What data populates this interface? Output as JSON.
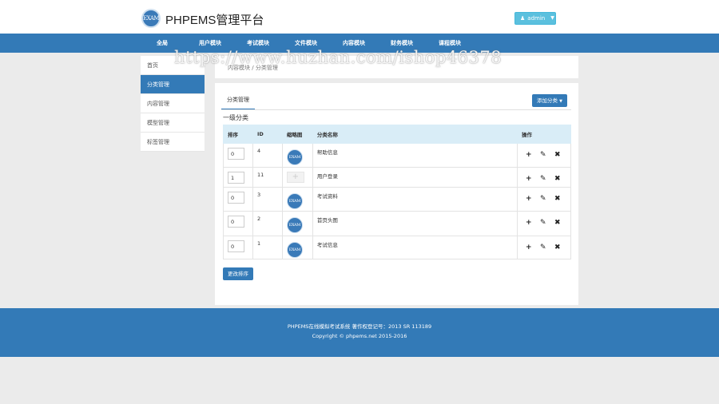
{
  "header": {
    "logo_mark": "EXAM",
    "brand": "PHPEMS管理平台",
    "user_icon": "user-icon",
    "user_label": "admin"
  },
  "nav": [
    "全局",
    "用户模块",
    "考试模块",
    "文件模块",
    "内容模块",
    "财务模块",
    "课程模块"
  ],
  "watermark": "https://www.huzhan.com/ishop46378",
  "sidebar": {
    "items": [
      {
        "label": "首页"
      },
      {
        "label": "分类管理"
      },
      {
        "label": "内容管理"
      },
      {
        "label": "模型管理"
      },
      {
        "label": "标签管理"
      }
    ],
    "active": "分类管理"
  },
  "breadcrumb": {
    "parent": "内容模块",
    "separator": "/",
    "current": "分类管理"
  },
  "panel": {
    "tab": "分类管理",
    "add_button": "添加分类",
    "section_title": "一级分类",
    "columns": [
      "排序",
      "ID",
      "缩略图",
      "分类名称",
      "操作"
    ],
    "rows": [
      {
        "order": "0",
        "id": "4",
        "thumb": "exam-logo",
        "name": "帮助信息"
      },
      {
        "order": "1",
        "id": "11",
        "thumb": "placeholder",
        "name": "用户登录"
      },
      {
        "order": "0",
        "id": "3",
        "thumb": "exam-logo",
        "name": "考试资料"
      },
      {
        "order": "0",
        "id": "2",
        "thumb": "exam-logo",
        "name": "首页头图"
      },
      {
        "order": "0",
        "id": "1",
        "thumb": "exam-logo",
        "name": "考试信息"
      }
    ],
    "row_actions": [
      "plus-icon",
      "edit-icon",
      "delete-icon"
    ],
    "save_button": "更改排序"
  },
  "footer": {
    "line1": "PHPEMS在线模拟考试系统 著作权登记号：2013 SR 113189",
    "line2": "Copyright © phpems.net 2015-2016"
  },
  "colors": {
    "primary": "#337ab7",
    "info": "#5bc0de",
    "table_header": "#d9edf7",
    "background": "#ebebeb"
  }
}
